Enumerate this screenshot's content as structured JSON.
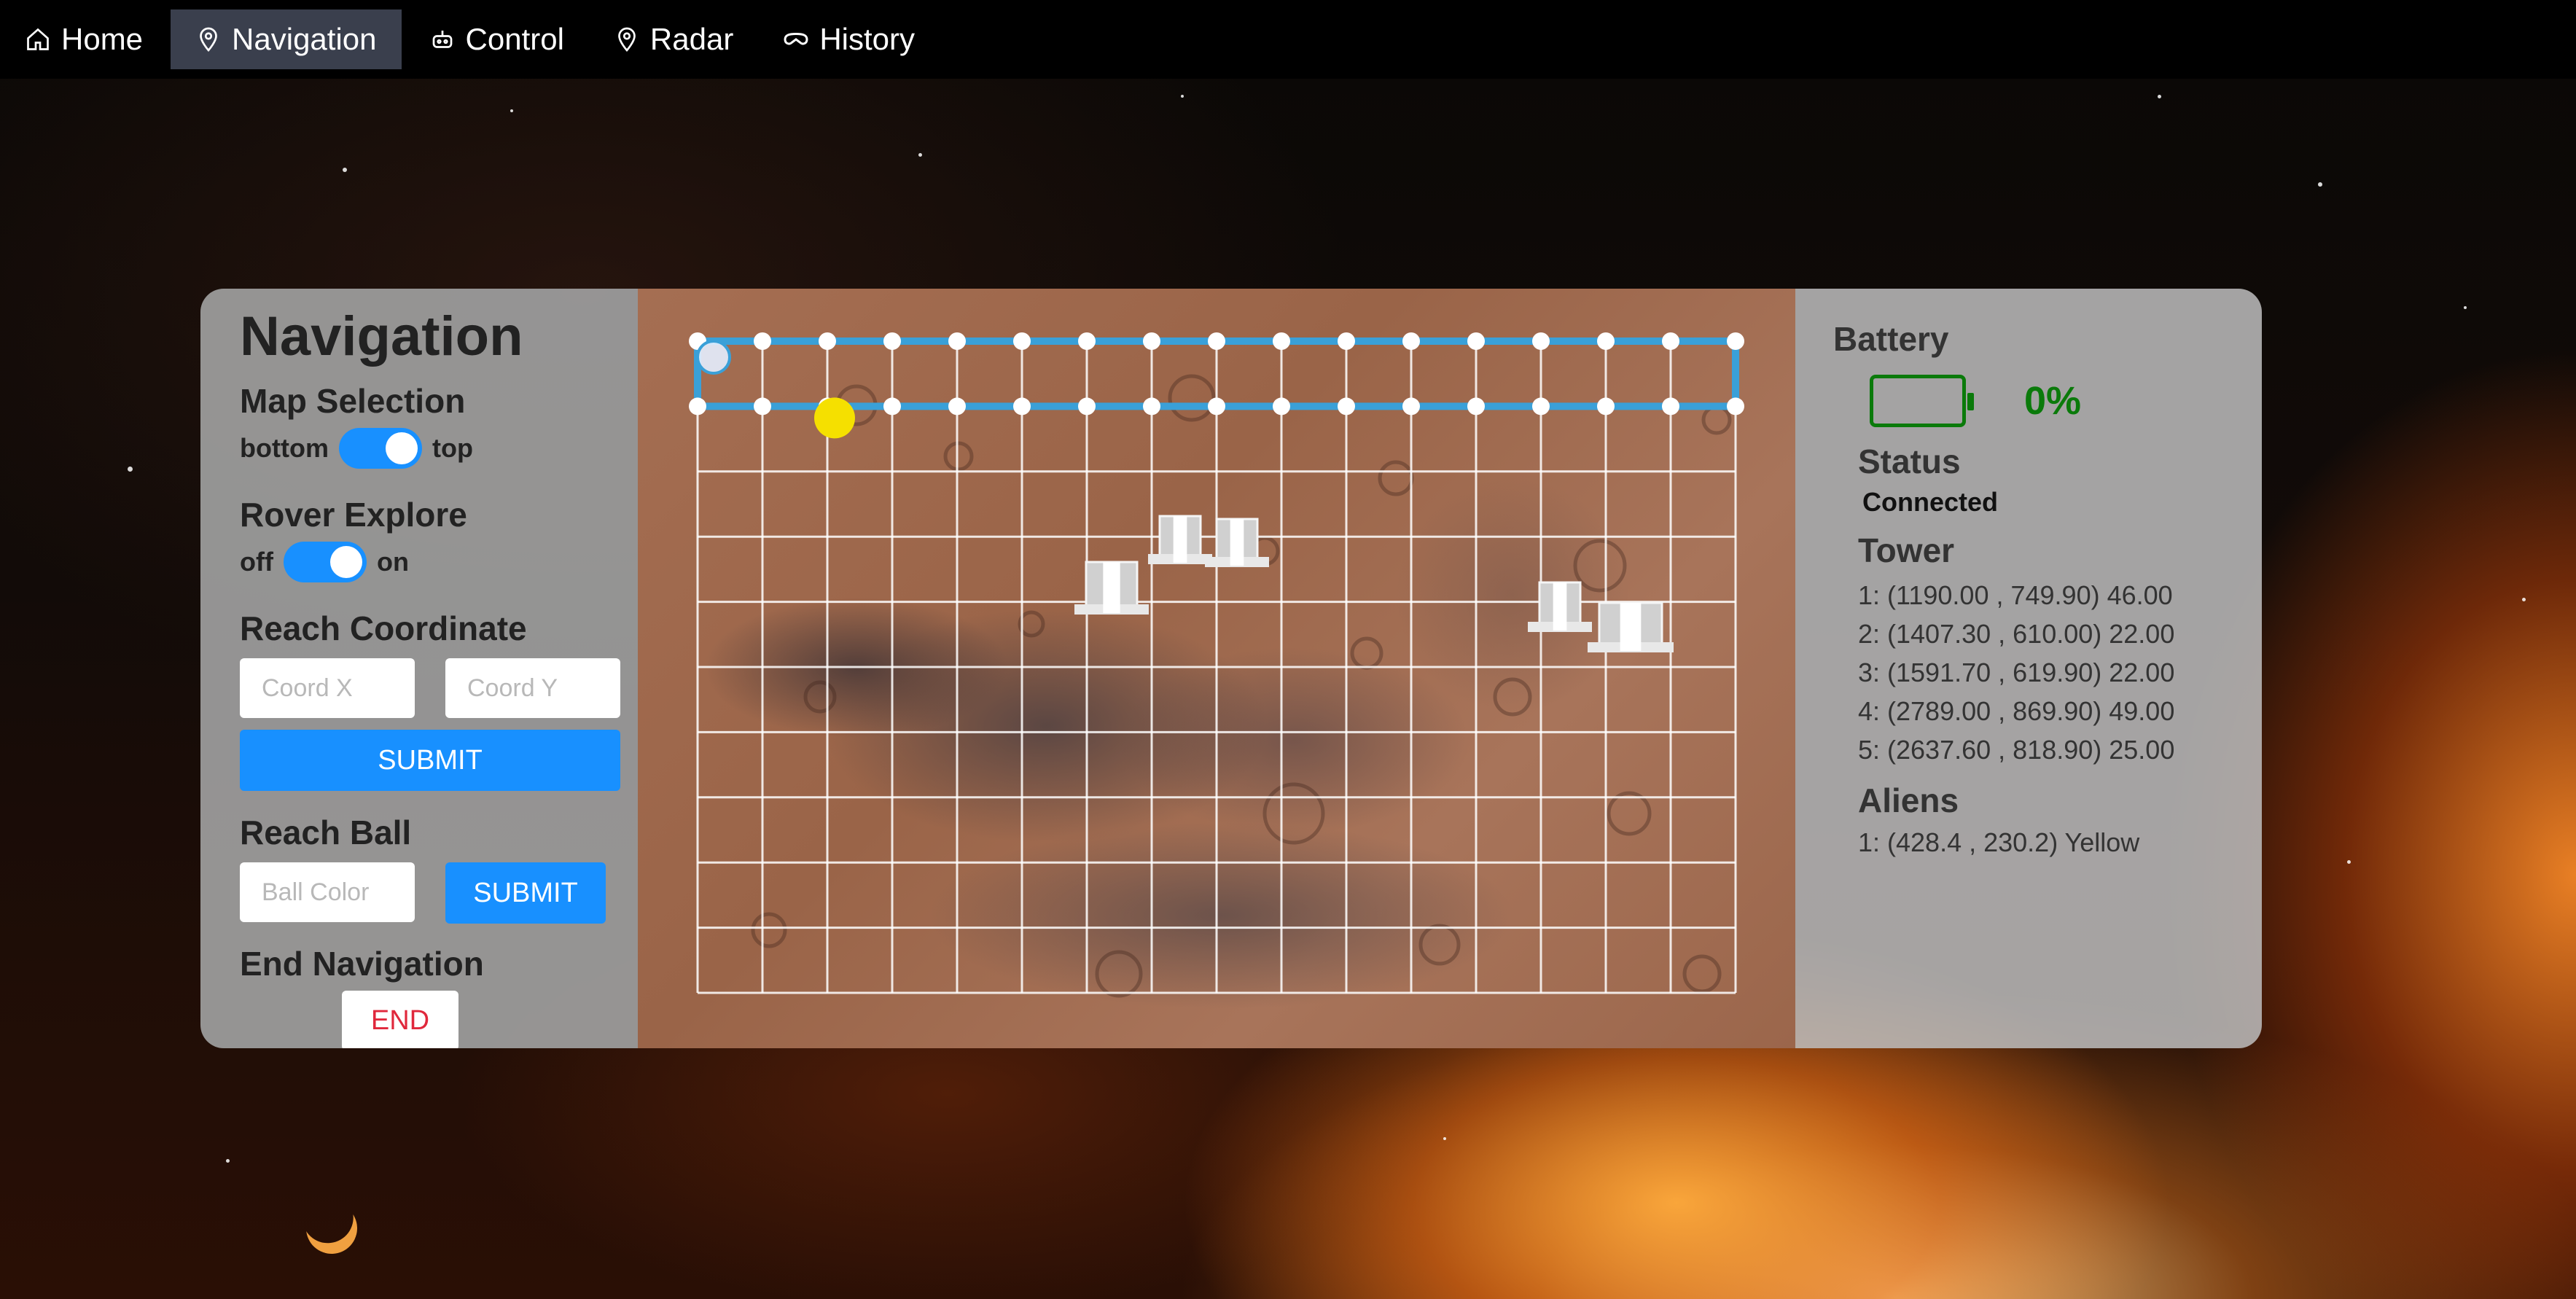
{
  "nav": {
    "items": [
      {
        "label": "Home",
        "icon": "home-icon",
        "active": false
      },
      {
        "label": "Navigation",
        "icon": "map-pin-icon",
        "active": true
      },
      {
        "label": "Control",
        "icon": "robot-icon",
        "active": false
      },
      {
        "label": "Radar",
        "icon": "map-pin-icon",
        "active": false
      },
      {
        "label": "History",
        "icon": "vr-glasses-icon",
        "active": false
      }
    ]
  },
  "left_panel": {
    "title": "Navigation",
    "map_selection": {
      "heading": "Map Selection",
      "off_label": "bottom",
      "on_label": "top",
      "value": "top"
    },
    "rover_explore": {
      "heading": "Rover Explore",
      "off_label": "off",
      "on_label": "on",
      "value": "on"
    },
    "reach_coordinate": {
      "heading": "Reach Coordinate",
      "x_placeholder": "Coord X",
      "y_placeholder": "Coord Y",
      "submit_label": "SUBMIT"
    },
    "reach_ball": {
      "heading": "Reach Ball",
      "color_placeholder": "Ball Color",
      "submit_label": "SUBMIT"
    },
    "end_navigation": {
      "heading": "End Navigation",
      "end_label": "END"
    }
  },
  "right_panel": {
    "battery": {
      "label": "Battery",
      "percent": "0%"
    },
    "status": {
      "label": "Status",
      "value": "Connected"
    },
    "tower": {
      "label": "Tower",
      "entries": [
        "1: (1190.00 ,  749.90) 46.00",
        "2: (1407.30 ,  610.00) 22.00",
        "3: (1591.70 ,  619.90) 22.00",
        "4: (2789.00 ,  869.90) 49.00",
        "5: (2637.60 ,  818.90) 25.00"
      ],
      "overlap_unit": "cm"
    },
    "aliens": {
      "label": "Aliens",
      "entries": [
        "1: (428.4 ,  230.2) Yellow"
      ]
    }
  },
  "colors": {
    "accent": "#1890ff",
    "battery": "#0a7a0a",
    "end": "#e0283c",
    "path": "#3aa0d8",
    "ball": "#f5e000"
  }
}
